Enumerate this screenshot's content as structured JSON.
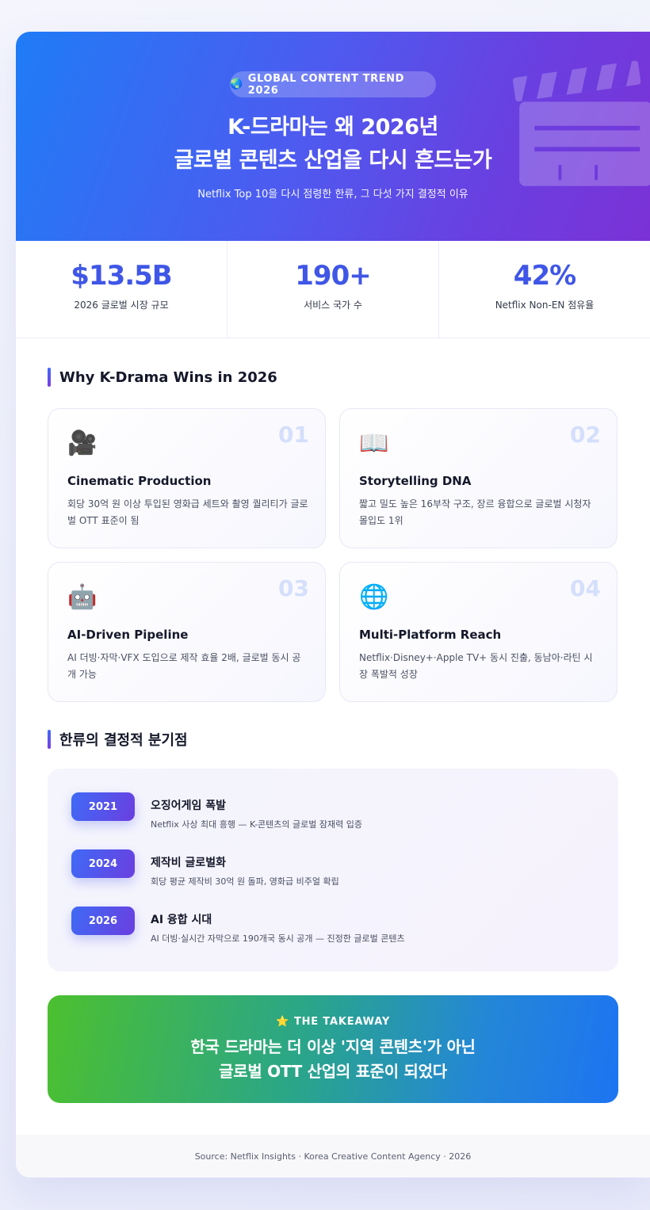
{
  "hero": {
    "badge_icon": "🌏",
    "badge_text": "GLOBAL CONTENT TREND 2026",
    "title_line1": "K-드라마는 왜 2026년",
    "title_line2": "글로벌 콘텐츠 산업을 다시 흔드는가",
    "subtitle": "Netflix Top 10을 다시 점령한 한류, 그 다섯 가지 결정적 이유",
    "background_icon": "clapperboard-icon"
  },
  "stats": [
    {
      "value": "$13.5B",
      "label": "2026 글로벌 시장 규모"
    },
    {
      "value": "190+",
      "label": "서비스 국가 수"
    },
    {
      "value": "42%",
      "label": "Netflix Non-EN 점유율"
    }
  ],
  "features_section": {
    "title": "Why K-Drama Wins in 2026",
    "items": [
      {
        "num": "01",
        "icon": "🎥",
        "icon_name": "movie-camera-icon",
        "title": "Cinematic Production",
        "desc": "회당 30억 원 이상 투입된 영화급 세트와 촬영 퀄리티가 글로벌 OTT 표준이 됨"
      },
      {
        "num": "02",
        "icon": "📖",
        "icon_name": "open-book-icon",
        "title": "Storytelling DNA",
        "desc": "짧고 밀도 높은 16부작 구조, 장르 융합으로 글로벌 시청자 몰입도 1위"
      },
      {
        "num": "03",
        "icon": "🤖",
        "icon_name": "robot-icon",
        "title": "AI-Driven Pipeline",
        "desc": "AI 더빙·자막·VFX 도입으로 제작 효율 2배, 글로벌 동시 공개 가능"
      },
      {
        "num": "04",
        "icon": "🌐",
        "icon_name": "globe-icon",
        "title": "Multi-Platform Reach",
        "desc": "Netflix·Disney+·Apple TV+ 동시 진출, 동남아·라틴 시장 폭발적 성장"
      }
    ]
  },
  "timeline_section": {
    "title": "한류의 결정적 분기점",
    "items": [
      {
        "year": "2021",
        "title": "오징어게임 폭발",
        "desc": "Netflix 사상 최대 흥행 — K-콘텐츠의 글로벌 잠재력 입증"
      },
      {
        "year": "2024",
        "title": "제작비 글로벌화",
        "desc": "회당 평균 제작비 30억 원 돌파, 영화급 비주얼 확립"
      },
      {
        "year": "2026",
        "title": "AI 융합 시대",
        "desc": "AI 더빙·실시간 자막으로 190개국 동시 공개 — 진정한 글로벌 콘텐츠"
      }
    ]
  },
  "takeaway": {
    "icon": "⭐",
    "label": "THE TAKEAWAY",
    "line1": "한국 드라마는 더 이상 '지역 콘텐츠'가 아닌",
    "line2": "글로벌 OTT 산업의 표준이 되었다"
  },
  "footer": {
    "text": "Source: Netflix Insights · Korea Creative Content Agency · 2026"
  },
  "colors": {
    "accent": "#3f56e6",
    "hero_start": "#1f7cf6",
    "hero_end": "#7b32d6",
    "takeaway_start": "#4cc02f",
    "takeaway_end": "#1d74f2"
  }
}
